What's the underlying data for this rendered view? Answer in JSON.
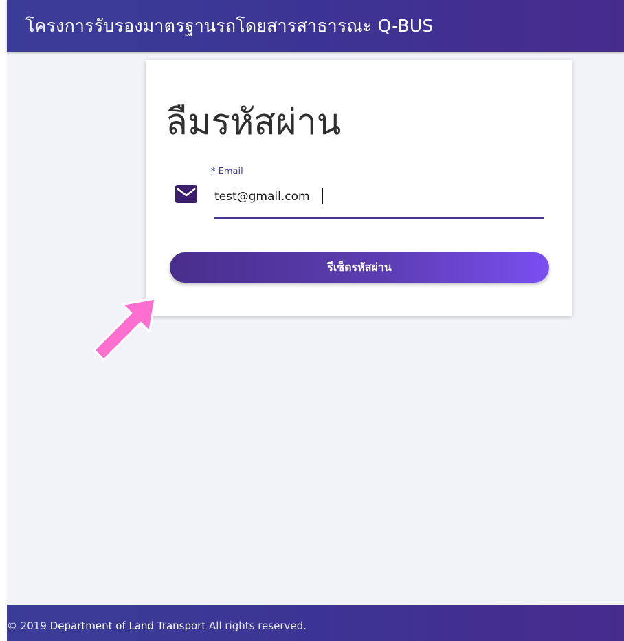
{
  "header": {
    "title": "โครงการรับรองมาตรฐานรถโดยสารสาธารณะ Q-BUS"
  },
  "card": {
    "title": "ลืมรหัสผ่าน",
    "email_field": {
      "required_marker": "*",
      "label": "Email",
      "value": "test@gmail.com",
      "icon": "mail-icon"
    },
    "reset_button_label": "รีเซ็ตรหัสผ่าน"
  },
  "annotation": {
    "arrow_color": "#ff6fd0",
    "icon": "pointer-arrow"
  },
  "footer": {
    "copyright": "© 2019",
    "org": "Department of Land Transport",
    "rights": "All rights reserved."
  },
  "colors": {
    "brand": "#3c3494",
    "accent": "#7a4ef0"
  }
}
